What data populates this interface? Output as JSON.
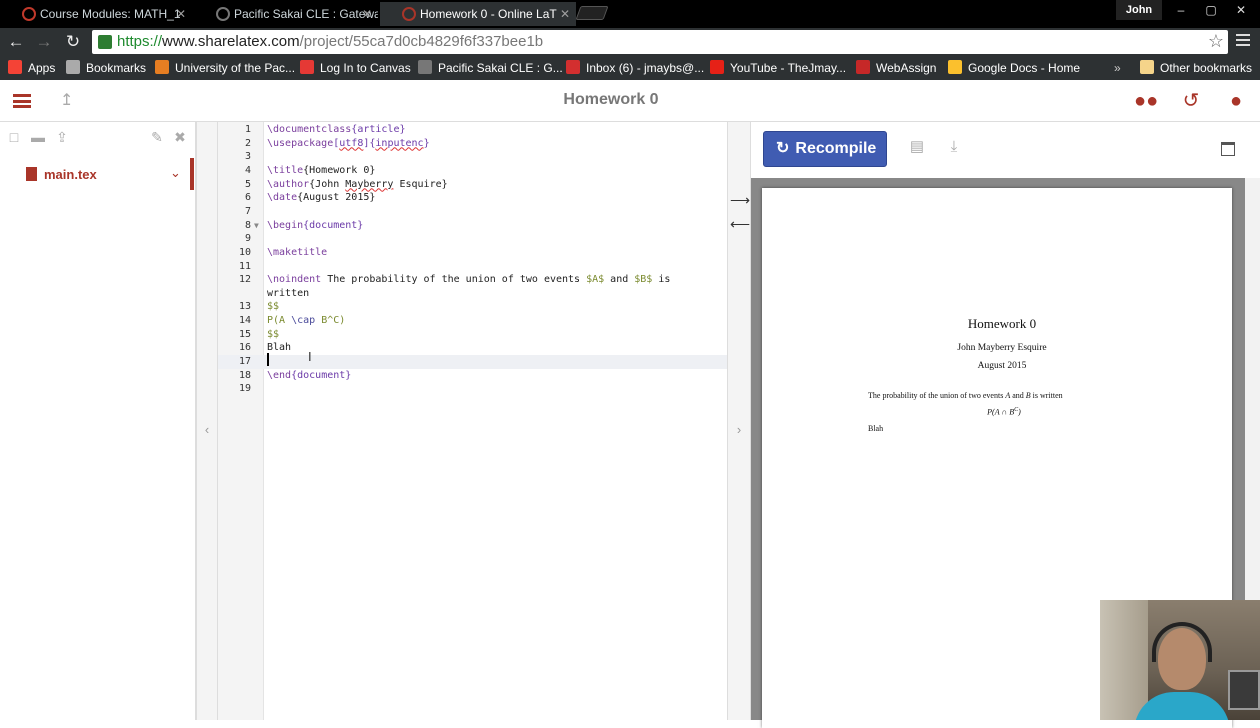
{
  "browser": {
    "tabs": [
      {
        "title": "Course Modules: MATH_1",
        "favicon_color": "#c0392b",
        "active": false
      },
      {
        "title": "Pacific Sakai CLE : Gatewa",
        "favicon_color": "#777777",
        "active": false
      },
      {
        "title": "Homework 0 - Online LaT",
        "favicon_color": "#a93529",
        "active": true
      }
    ],
    "user": "John",
    "window_controls": [
      "–",
      "▢",
      "✕"
    ],
    "url": {
      "scheme": "https://",
      "host": "www.sharelatex.com",
      "path": "/project/55ca7d0cb4829f6f337bee1b"
    },
    "bookmarks": [
      {
        "label": "Apps",
        "icon": "apps-grid-icon",
        "color": "#f44336"
      },
      {
        "label": "Bookmarks",
        "icon": "star-icon",
        "color": "#aaaaaa"
      },
      {
        "label": "University of the Pac...",
        "icon": "pacific-logo-icon",
        "color": "#e67e22"
      },
      {
        "label": "Log In to Canvas",
        "icon": "canvas-icon",
        "color": "#e53935"
      },
      {
        "label": "Pacific Sakai CLE : G...",
        "icon": "sakai-icon",
        "color": "#777777"
      },
      {
        "label": "Inbox (6) - jmaybs@...",
        "icon": "mail-icon",
        "color": "#d32f2f"
      },
      {
        "label": "YouTube - TheJmay...",
        "icon": "youtube-icon",
        "color": "#e62117"
      },
      {
        "label": "WebAssign",
        "icon": "webassign-icon",
        "color": "#c62828"
      },
      {
        "label": "Google Docs - Home",
        "icon": "google-drive-icon",
        "color": "#fbc02d"
      }
    ],
    "more_bookmarks": "»",
    "other_bookmarks": "Other bookmarks"
  },
  "app": {
    "project_title": "Homework 0",
    "accent_color": "#a93529",
    "files": [
      {
        "name": "main.tex"
      }
    ],
    "recompile_label": "Recompile"
  },
  "editor": {
    "lines": [
      {
        "n": "1",
        "html": "<span class=\"kw\">\\documentclass</span><span class=\"br\">{article}</span>"
      },
      {
        "n": "2",
        "html": "<span class=\"kw\">\\usepackage</span><span class=\"br\">[<span class=\"spell\">utf8</span>]{<span class=\"spell\">inputenc</span>}</span>"
      },
      {
        "n": "3",
        "html": ""
      },
      {
        "n": "4",
        "html": "<span class=\"kw\">\\title</span>{Homework 0}"
      },
      {
        "n": "5",
        "html": "<span class=\"kw\">\\author</span>{John <span class=\"spell\">Mayberry</span> Esquire}"
      },
      {
        "n": "6",
        "html": "<span class=\"kw\">\\date</span>{August 2015}"
      },
      {
        "n": "7",
        "html": ""
      },
      {
        "n": "8",
        "html": "<span class=\"kw\">\\begin</span><span class=\"br\">{document}</span>",
        "fold": true
      },
      {
        "n": "9",
        "html": ""
      },
      {
        "n": "10",
        "html": "<span class=\"kw\">\\maketitle</span>"
      },
      {
        "n": "11",
        "html": ""
      },
      {
        "n": "12",
        "html": "<span class=\"kw\">\\noindent</span> The probability of the union of two events <span class=\"math\">$A$</span> and <span class=\"math\">$B$</span> is"
      },
      {
        "n": "",
        "html": "written"
      },
      {
        "n": "13",
        "html": "<span class=\"math\">$$</span>"
      },
      {
        "n": "14",
        "html": "<span class=\"math\">P(A <span class=\"cmd\">\\cap</span> B^C)</span>"
      },
      {
        "n": "15",
        "html": "<span class=\"math\">$$</span>"
      },
      {
        "n": "16",
        "html": "Blah"
      },
      {
        "n": "17",
        "html": "",
        "active": true
      },
      {
        "n": "18",
        "html": "<span class=\"kw\">\\end</span><span class=\"br\">{document}</span>"
      },
      {
        "n": "19",
        "html": ""
      }
    ]
  },
  "pdf": {
    "title": "Homework 0",
    "author": "John Mayberry Esquire",
    "date": "August 2015",
    "body_pre": "The probability of the union of two events ",
    "body_A": "A",
    "body_mid": " and ",
    "body_B": "B",
    "body_post": " is written",
    "formula": "P(A ∩ B",
    "formula_sup": "C",
    "formula_close": ")",
    "blah": "Blah"
  }
}
